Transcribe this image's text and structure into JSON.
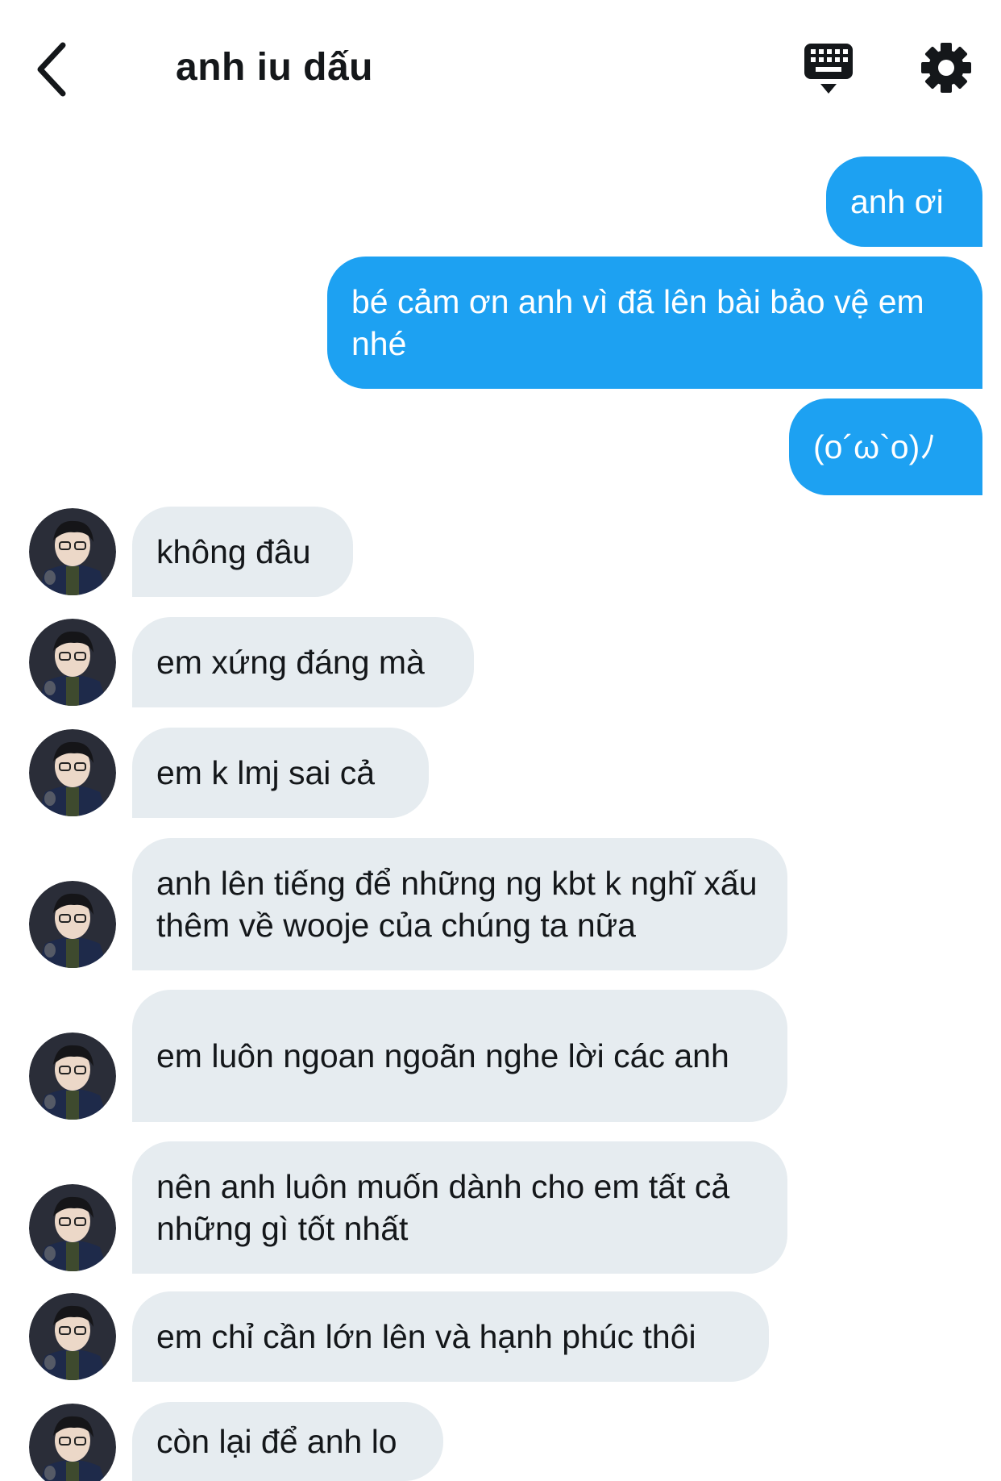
{
  "header": {
    "title": "anh iu dấu",
    "back_icon": "chevron-left-icon",
    "keyboard_icon": "keyboard-icon",
    "settings_icon": "gear-icon"
  },
  "colors": {
    "outgoing_bubble": "#1da1f2",
    "incoming_bubble": "#e6ecf0",
    "text_dark": "#14171a"
  },
  "messages": [
    {
      "from": "me",
      "text": "anh ơi"
    },
    {
      "from": "me",
      "text": "bé cảm ơn anh vì đã lên bài bảo vệ em nhé"
    },
    {
      "from": "me",
      "text": "(o´ω`o)ﾉ"
    },
    {
      "from": "them",
      "text": "không đâu"
    },
    {
      "from": "them",
      "text": "em xứng đáng mà"
    },
    {
      "from": "them",
      "text": "em k lmj sai cả"
    },
    {
      "from": "them",
      "text": "anh lên tiếng để những ng kbt k nghĩ xấu thêm về wooje của chúng ta nữa"
    },
    {
      "from": "them",
      "text": "em luôn ngoan ngoãn nghe lời các anh"
    },
    {
      "from": "them",
      "text": "nên anh luôn muốn dành cho em tất cả những gì tốt nhất"
    },
    {
      "from": "them",
      "text": "em chỉ cần lớn lên và hạnh phúc thôi"
    },
    {
      "from": "them",
      "text": "còn lại để anh lo"
    }
  ]
}
